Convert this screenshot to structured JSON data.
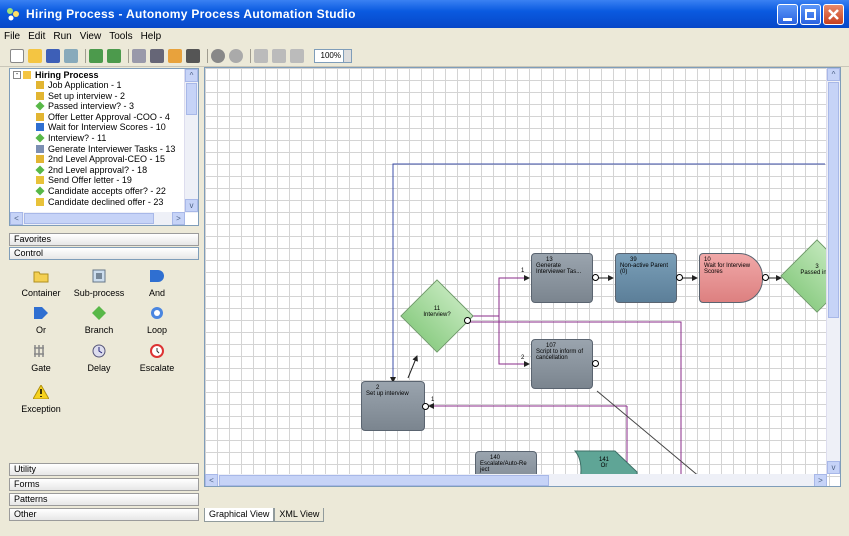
{
  "window": {
    "title": "Hiring Process - Autonomy Process Automation Studio"
  },
  "menu": [
    "File",
    "Edit",
    "Run",
    "View",
    "Tools",
    "Help"
  ],
  "toolbar": {
    "zoom": "100%"
  },
  "tree": {
    "root": "Hiring Process",
    "items": [
      {
        "label": "Job Application - 1",
        "icon": "form-icon"
      },
      {
        "label": "Set up interview - 2",
        "icon": "form-icon"
      },
      {
        "label": "Passed interview? - 3",
        "icon": "branch-icon"
      },
      {
        "label": "Offer Letter Approval -COO - 4",
        "icon": "form-icon"
      },
      {
        "label": "Wait for Interview Scores - 10",
        "icon": "and-icon"
      },
      {
        "label": "Interview? - 11",
        "icon": "branch-icon"
      },
      {
        "label": "Generate Interviewer Tasks - 13",
        "icon": "script-icon"
      },
      {
        "label": "2nd Level Approval-CEO - 15",
        "icon": "form-icon"
      },
      {
        "label": "2nd Level approval? - 18",
        "icon": "branch-icon"
      },
      {
        "label": "Send Offer letter - 19",
        "icon": "email-icon"
      },
      {
        "label": "Candidate accepts offer? - 22",
        "icon": "branch-icon"
      },
      {
        "label": "Candidate declined offer - 23",
        "icon": "email-icon"
      }
    ]
  },
  "panels": {
    "favorites": "Favorites",
    "control": "Control",
    "utility": "Utility",
    "forms": "Forms",
    "patterns": "Patterns",
    "other": "Other"
  },
  "palette": [
    {
      "label": "Container",
      "icon": "container-icon"
    },
    {
      "label": "Sub-process",
      "icon": "subprocess-icon"
    },
    {
      "label": "And",
      "icon": "and-icon"
    },
    {
      "label": "Or",
      "icon": "or-icon"
    },
    {
      "label": "Branch",
      "icon": "branch-icon"
    },
    {
      "label": "Loop",
      "icon": "loop-icon"
    },
    {
      "label": "Gate",
      "icon": "gate-icon"
    },
    {
      "label": "Delay",
      "icon": "delay-icon"
    },
    {
      "label": "Escalate",
      "icon": "escalate-icon"
    },
    {
      "label": "Exception",
      "icon": "exception-icon"
    }
  ],
  "canvas": {
    "nodes": {
      "n13": {
        "id": "13",
        "label": "Generate Interviewer Tas..."
      },
      "n39": {
        "id": "39",
        "label": "Non-active Parent",
        "extra": "(0)"
      },
      "n10": {
        "id": "10",
        "label": "Wait for Interview Scores"
      },
      "n3": {
        "id": "3",
        "label": "Passed inter"
      },
      "n11": {
        "id": "11",
        "label": "Interview?"
      },
      "n107": {
        "id": "107",
        "label": "Script to inform of cancellation"
      },
      "n2": {
        "id": "2",
        "label": "Set up interview"
      },
      "n140": {
        "id": "140",
        "label": "Escalate/Auto-Re ject"
      },
      "n141": {
        "id": "141",
        "label": "Or"
      }
    },
    "edge_labels": {
      "e1": "1",
      "e2": "2",
      "e3": "1"
    }
  },
  "tabs": [
    {
      "label": "Graphical View",
      "active": true
    },
    {
      "label": "XML View",
      "active": false
    }
  ]
}
